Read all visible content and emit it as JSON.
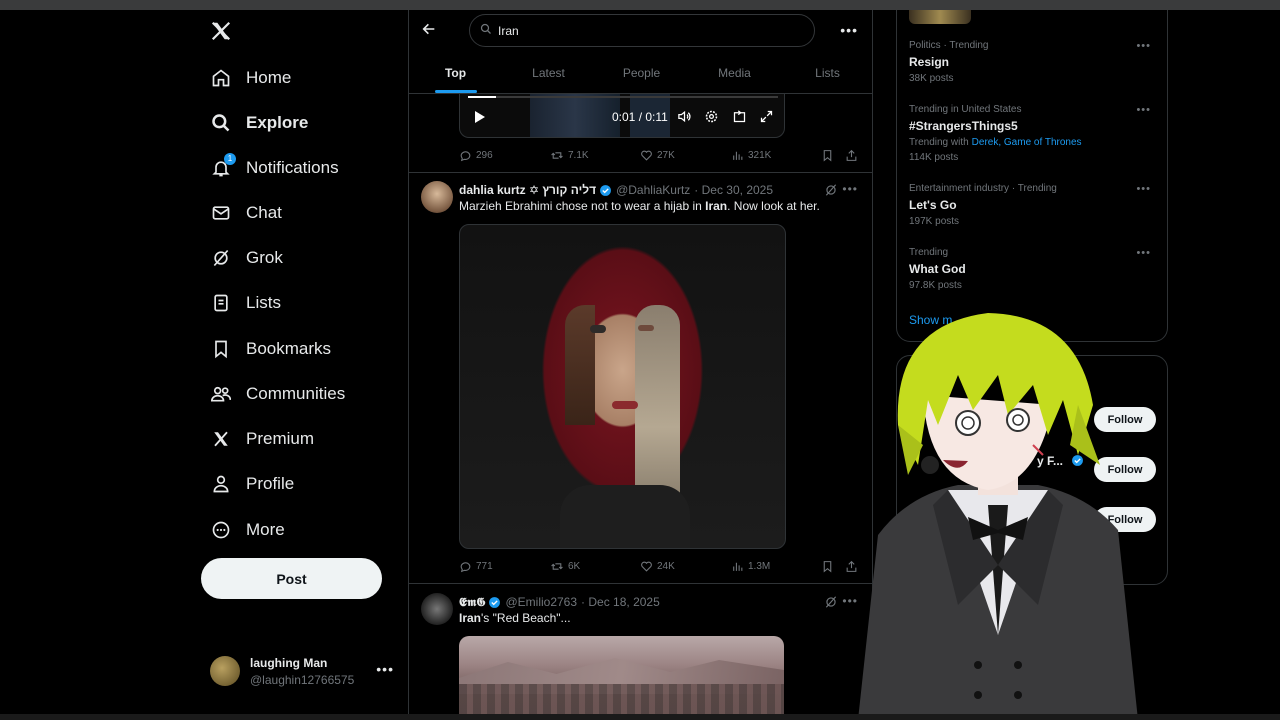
{
  "nav": {
    "items": [
      {
        "label": "Home",
        "icon": "home-icon"
      },
      {
        "label": "Explore",
        "icon": "search-icon",
        "active": true
      },
      {
        "label": "Notifications",
        "icon": "bell-icon",
        "badge": "1"
      },
      {
        "label": "Chat",
        "icon": "mail-icon"
      },
      {
        "label": "Grok",
        "icon": "grok-icon"
      },
      {
        "label": "Lists",
        "icon": "list-icon"
      },
      {
        "label": "Bookmarks",
        "icon": "bookmark-icon"
      },
      {
        "label": "Communities",
        "icon": "communities-icon"
      },
      {
        "label": "Premium",
        "icon": "x-logo-icon"
      },
      {
        "label": "Profile",
        "icon": "person-icon"
      },
      {
        "label": "More",
        "icon": "more-circle-icon"
      }
    ],
    "post_label": "Post"
  },
  "account": {
    "name": "laughing Man",
    "handle": "@laughin12766575"
  },
  "search": {
    "value": "Iran"
  },
  "tabs": [
    "Top",
    "Latest",
    "People",
    "Media",
    "Lists"
  ],
  "video": {
    "time": "0:01 / 0:11",
    "progress": 0.09
  },
  "tweets": [
    {
      "stats": {
        "replies": "296",
        "reposts": "7.1K",
        "likes": "27K",
        "views": "321K"
      }
    },
    {
      "name": "dahlia kurtz ✡ דליה קורץ",
      "handle": "@DahliaKurtz",
      "date": "· Dec 30, 2025",
      "text_before": "Marzieh Ebrahimi chose not to wear a hijab in ",
      "text_bold": "Iran",
      "text_after": ". Now look at her.",
      "stats": {
        "replies": "771",
        "reposts": "6K",
        "likes": "24K",
        "views": "1.3M"
      }
    },
    {
      "name": "𝕰𝖒𝕲",
      "handle": "@Emilio2763",
      "date": "· Dec 18, 2025",
      "text_bold": "Iran",
      "text_after": "'s \"Red Beach\"..."
    }
  ],
  "trends": [
    {
      "meta": "Politics · Trending",
      "topic": "Resign",
      "count": "38K posts"
    },
    {
      "meta": "Trending in United States",
      "topic": "#StrangersThings5",
      "with_label": "Trending with",
      "with_links": "Derek, Game of Thrones",
      "count": "114K posts"
    },
    {
      "meta": "Entertainment industry · Trending",
      "topic": "Let's Go",
      "count": "197K posts"
    },
    {
      "meta": "Trending",
      "topic": "What God",
      "count": "97.8K posts"
    }
  ],
  "show_more": "Show m",
  "who_to_follow": {
    "follow_label": "Follow",
    "partial_name": "y F..."
  },
  "colors": {
    "accent": "#1d9bf0",
    "background": "#000000",
    "border": "#2f3336",
    "muted": "#71767b"
  }
}
